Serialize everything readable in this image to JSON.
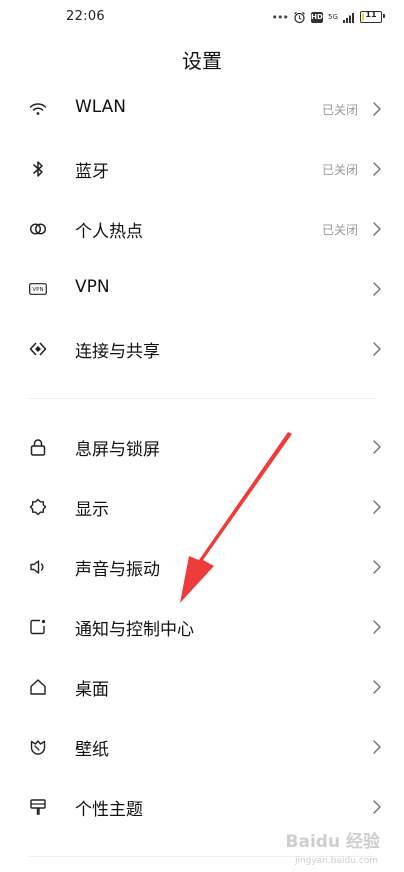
{
  "status_bar": {
    "time": "22:06",
    "network_label": "5G",
    "battery_level": "11",
    "battery_fraction": 0.11,
    "icons": [
      "dots-icon",
      "alarm-icon",
      "hd-icon",
      "signal-icon",
      "battery-icon"
    ]
  },
  "title": "设置",
  "section1": [
    {
      "name": "wlan",
      "label": "WLAN",
      "status": "已关闭",
      "icon": "wifi-icon"
    },
    {
      "name": "bluetooth",
      "label": "蓝牙",
      "status": "已关闭",
      "icon": "bluetooth-icon"
    },
    {
      "name": "hotspot",
      "label": "个人热点",
      "status": "已关闭",
      "icon": "hotspot-icon"
    },
    {
      "name": "vpn",
      "label": "VPN",
      "status": "",
      "icon": "vpn-icon"
    },
    {
      "name": "connection-sharing",
      "label": "连接与共享",
      "status": "",
      "icon": "connection-icon"
    }
  ],
  "section2": [
    {
      "name": "lock-screen",
      "label": "息屏与锁屏",
      "icon": "lock-icon"
    },
    {
      "name": "display",
      "label": "显示",
      "icon": "brightness-icon"
    },
    {
      "name": "sound-vibration",
      "label": "声音与振动",
      "icon": "speaker-icon"
    },
    {
      "name": "notification-control-center",
      "label": "通知与控制中心",
      "icon": "notification-icon"
    },
    {
      "name": "home-screen",
      "label": "桌面",
      "icon": "home-icon"
    },
    {
      "name": "wallpaper",
      "label": "壁纸",
      "icon": "wallpaper-icon"
    },
    {
      "name": "themes",
      "label": "个性主题",
      "icon": "theme-icon"
    }
  ],
  "vpn_icon_text": "VPN",
  "annotation": {
    "color": "#ee3b3b",
    "points_to": "通知与控制中心"
  },
  "watermark": {
    "text": "Baidu 经验",
    "sub": "jingyan.baidu.com"
  }
}
